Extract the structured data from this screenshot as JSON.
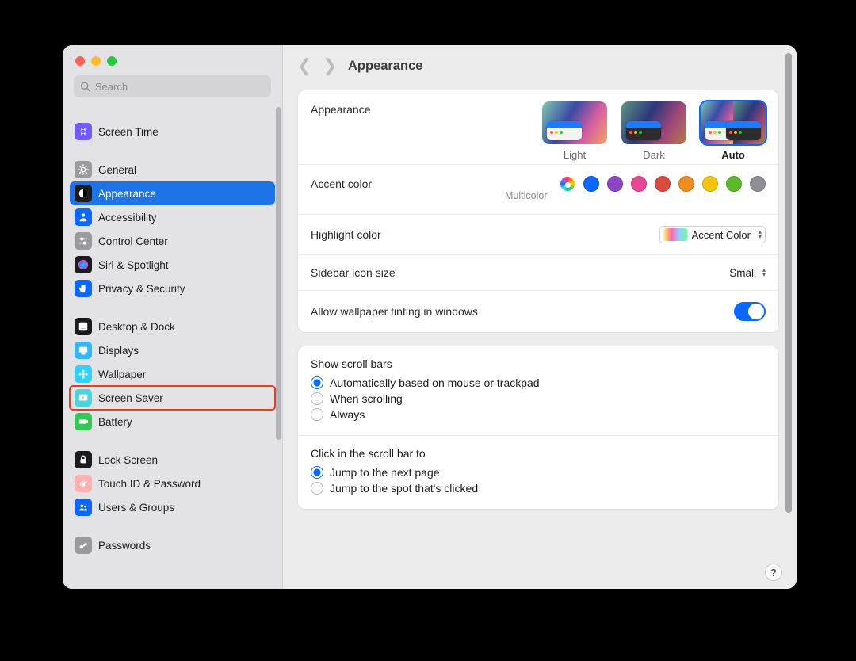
{
  "window_title": "Appearance",
  "search": {
    "placeholder": "Search"
  },
  "sidebar": {
    "groups": [
      {
        "items": [
          {
            "label": "Screen Time",
            "icon": "hourglass",
            "icon_bg": "#6f5cff"
          }
        ]
      },
      {
        "items": [
          {
            "label": "General",
            "icon": "gear",
            "icon_bg": "#9a9a9e"
          },
          {
            "label": "Appearance",
            "icon": "contrast",
            "icon_bg": "#1c1c1e",
            "selected": true
          },
          {
            "label": "Accessibility",
            "icon": "person",
            "icon_bg": "#0a68ff"
          },
          {
            "label": "Control Center",
            "icon": "sliders",
            "icon_bg": "#9a9a9e"
          },
          {
            "label": "Siri & Spotlight",
            "icon": "siri",
            "icon_bg": "#1c1c1e"
          },
          {
            "label": "Privacy & Security",
            "icon": "hand",
            "icon_bg": "#0a68ff"
          }
        ]
      },
      {
        "items": [
          {
            "label": "Desktop & Dock",
            "icon": "dock",
            "icon_bg": "#1c1c1e"
          },
          {
            "label": "Displays",
            "icon": "display",
            "icon_bg": "#2fb7ff"
          },
          {
            "label": "Wallpaper",
            "icon": "flower",
            "icon_bg": "#2fd1ff"
          },
          {
            "label": "Screen Saver",
            "icon": "screensaver",
            "icon_bg": "#4bd3e0",
            "highlight": true
          },
          {
            "label": "Battery",
            "icon": "battery",
            "icon_bg": "#31c954"
          }
        ]
      },
      {
        "items": [
          {
            "label": "Lock Screen",
            "icon": "lock",
            "icon_bg": "#1c1c1e"
          },
          {
            "label": "Touch ID & Password",
            "icon": "fingerprint",
            "icon_bg": "#ffb0b0"
          },
          {
            "label": "Users & Groups",
            "icon": "users",
            "icon_bg": "#0a68ff"
          }
        ]
      },
      {
        "items": [
          {
            "label": "Passwords",
            "icon": "key",
            "icon_bg": "#9a9a9e"
          }
        ]
      }
    ]
  },
  "appearance_row_label": "Appearance",
  "themes": [
    {
      "label": "Light",
      "mode": "light"
    },
    {
      "label": "Dark",
      "mode": "dark"
    },
    {
      "label": "Auto",
      "mode": "auto",
      "selected": true
    }
  ],
  "accent": {
    "label": "Accent color",
    "sublabel": "Multicolor",
    "colors": [
      {
        "name": "multicolor",
        "css": "multi",
        "selected": true
      },
      {
        "name": "blue",
        "css": "#0a68ff"
      },
      {
        "name": "purple",
        "css": "#8c46c6"
      },
      {
        "name": "pink",
        "css": "#e44796"
      },
      {
        "name": "red",
        "css": "#d9493c"
      },
      {
        "name": "orange",
        "css": "#ef8b1f"
      },
      {
        "name": "yellow",
        "css": "#f2c40f"
      },
      {
        "name": "green",
        "css": "#5cb92c"
      },
      {
        "name": "graphite",
        "css": "#8f8f93"
      }
    ]
  },
  "highlight": {
    "label": "Highlight color",
    "value": "Accent Color"
  },
  "sidebar_size": {
    "label": "Sidebar icon size",
    "value": "Small"
  },
  "tinting": {
    "label": "Allow wallpaper tinting in windows",
    "on": true
  },
  "scrollbars": {
    "heading": "Show scroll bars",
    "options": [
      {
        "label": "Automatically based on mouse or trackpad",
        "checked": true
      },
      {
        "label": "When scrolling",
        "checked": false
      },
      {
        "label": "Always",
        "checked": false
      }
    ]
  },
  "scrollclick": {
    "heading": "Click in the scroll bar to",
    "options": [
      {
        "label": "Jump to the next page",
        "checked": true
      },
      {
        "label": "Jump to the spot that's clicked",
        "checked": false
      }
    ]
  }
}
